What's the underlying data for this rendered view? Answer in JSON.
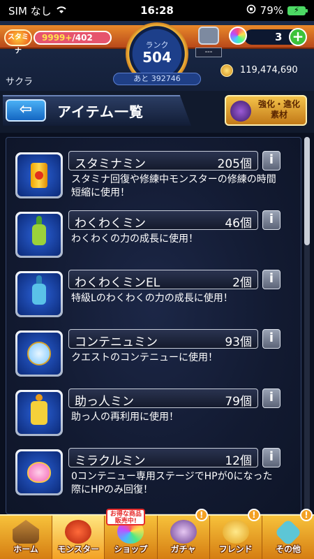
{
  "status_bar": {
    "carrier": "SIM なし",
    "time": "16:28",
    "battery_percent": "79%"
  },
  "header": {
    "stamina_icon_label": "スタミナ",
    "stamina_current": "9999+",
    "stamina_max": "/402",
    "rank_label": "ランク",
    "rank_value": "504",
    "rank_remaining": "あと 392746",
    "hatch_sub": "---",
    "orb_count": "3",
    "orb_plus": "+",
    "user_name": "サクラ",
    "coins": "119,474,690"
  },
  "title_bar": {
    "back_icon": "back-arrow-icon",
    "back_glyph": "⇦",
    "title": "アイテム一覧",
    "material_label_line1": "強化・進化",
    "material_label_line2": "素材"
  },
  "items": [
    {
      "name": "スタミナミン",
      "count": "205個",
      "desc": "スタミナ回復や修練中モンスターの修練の時間短縮に使用！",
      "icon": "stamina-can-icon"
    },
    {
      "name": "わくわくミン",
      "count": "46個",
      "desc": "わくわくの力の成長に使用！",
      "icon": "green-bottle-icon"
    },
    {
      "name": "わくわくミンEL",
      "count": "2個",
      "desc": "特級Lのわくわくの力の成長に使用！",
      "icon": "blue-bottle-icon"
    },
    {
      "name": "コンテニュミン",
      "count": "93個",
      "desc": "クエストのコンテニューに使用！",
      "icon": "flask-icon"
    },
    {
      "name": "助っ人ミン",
      "count": "79個",
      "desc": "助っ人の再利用に使用！",
      "icon": "jar-icon"
    },
    {
      "name": "ミラクルミン",
      "count": "12個",
      "desc": "0コンテニュー専用ステージでHPが0になった際にHPのみ回復！",
      "icon": "heart-bottle-icon"
    }
  ],
  "info_glyph": "i",
  "bottom_nav": {
    "tabs": [
      {
        "label": "ホーム",
        "icon": "home-icon"
      },
      {
        "label": "モンスター",
        "icon": "monster-icon"
      },
      {
        "label": "ショップ",
        "icon": "shop-icon"
      },
      {
        "label": "ガチャ",
        "icon": "gacha-icon"
      },
      {
        "label": "フレンド",
        "icon": "friend-icon"
      },
      {
        "label": "その他",
        "icon": "other-icon"
      }
    ],
    "shop_badge": "お得な商品販売中!",
    "alert_glyph": "!"
  },
  "colors": {
    "accent_orange": "#e9892a",
    "nav_gold": "#f7c23b",
    "panel_bg": "#121a31",
    "orb_green": "#3cc23a"
  }
}
